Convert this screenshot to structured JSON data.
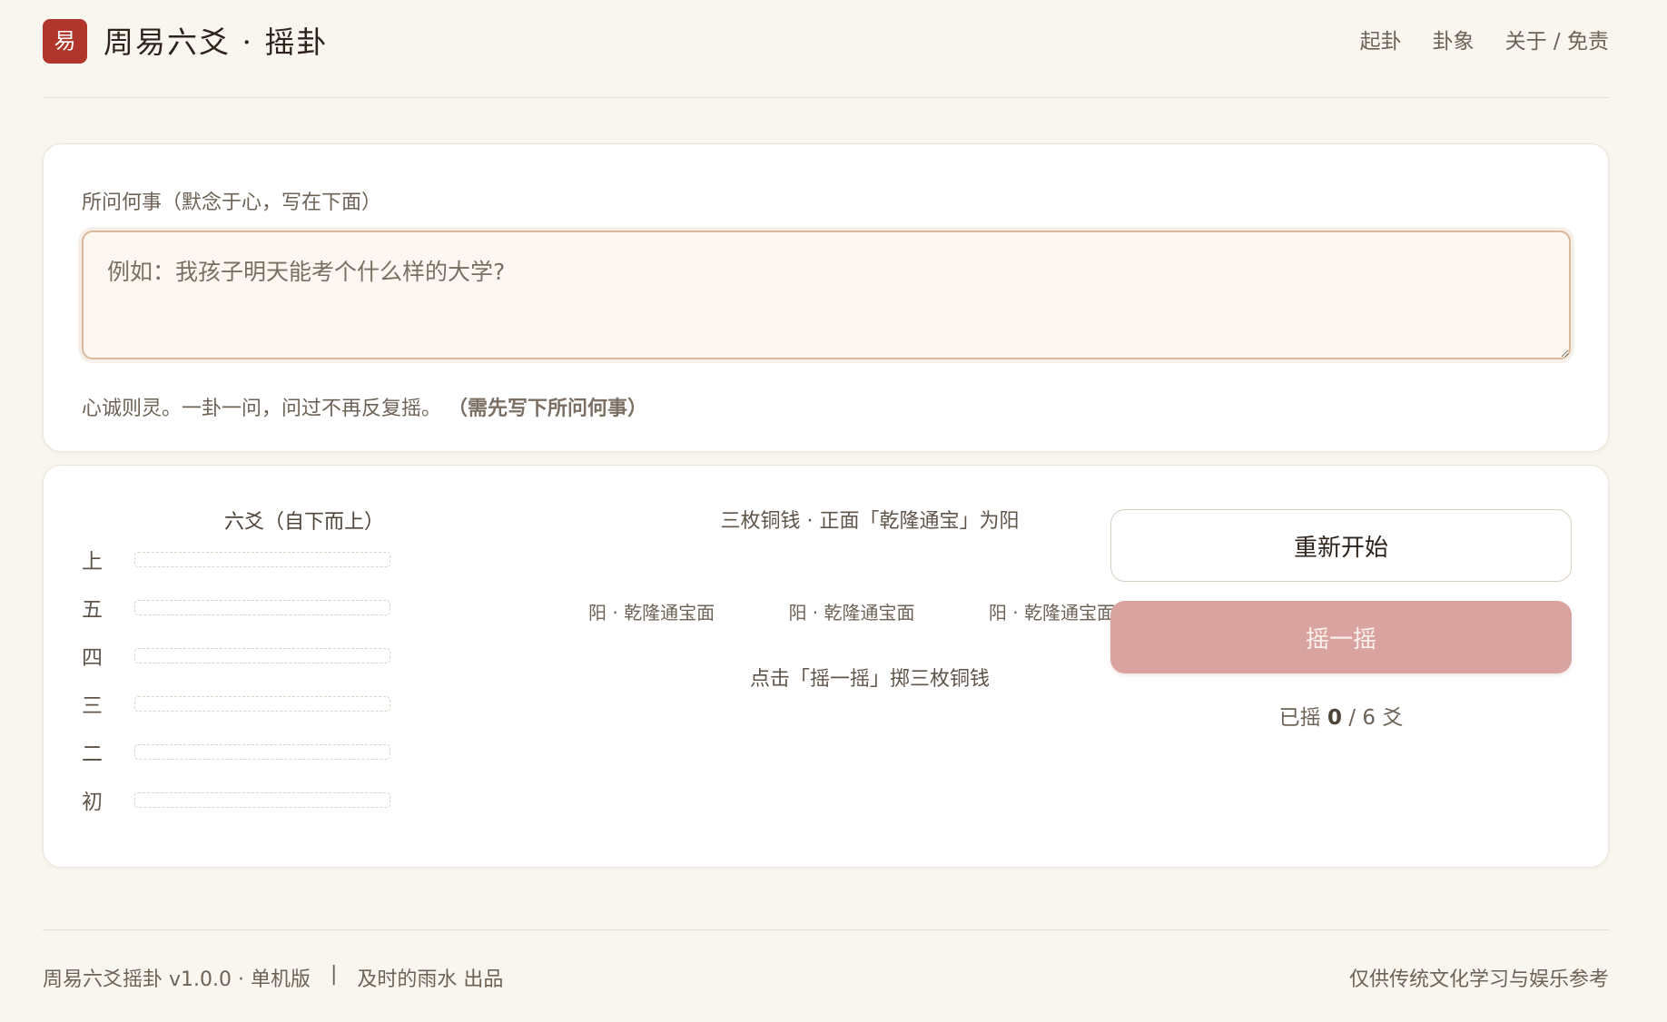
{
  "header": {
    "logo_char": "易",
    "brand": "周易六爻 · 摇卦",
    "nav": [
      "起卦",
      "卦象",
      "关于 / 免责"
    ]
  },
  "question": {
    "label": "所问何事（默念于心，写在下面）",
    "placeholder": "例如：我孩子明天能考个什么样的大学?",
    "value": "",
    "hint": "心诚则灵。一卦一问，问过不再反复摇。",
    "hint_strong": "（需先写下所问何事）"
  },
  "yao": {
    "title": "六爻（自下而上）",
    "rows": [
      "上",
      "五",
      "四",
      "三",
      "二",
      "初"
    ]
  },
  "coins": {
    "title": "三枚铜钱 · 正面「乾隆通宝」为阳",
    "items": [
      "阳 · 乾隆通宝面",
      "阳 · 乾隆通宝面",
      "阳 · 乾隆通宝面"
    ],
    "hint": "点击「摇一摇」掷三枚铜钱"
  },
  "actions": {
    "restart": "重新开始",
    "shake": "摇一摇",
    "progress_prefix": "已摇",
    "progress_done": 0,
    "progress_total": "/ 6 爻"
  },
  "footer": {
    "version": "周易六爻摇卦 v1.0.0 · 单机版",
    "sep": "|",
    "author": "及时的雨水 出品",
    "disclaimer": "仅供传统文化学习与娱乐参考"
  }
}
